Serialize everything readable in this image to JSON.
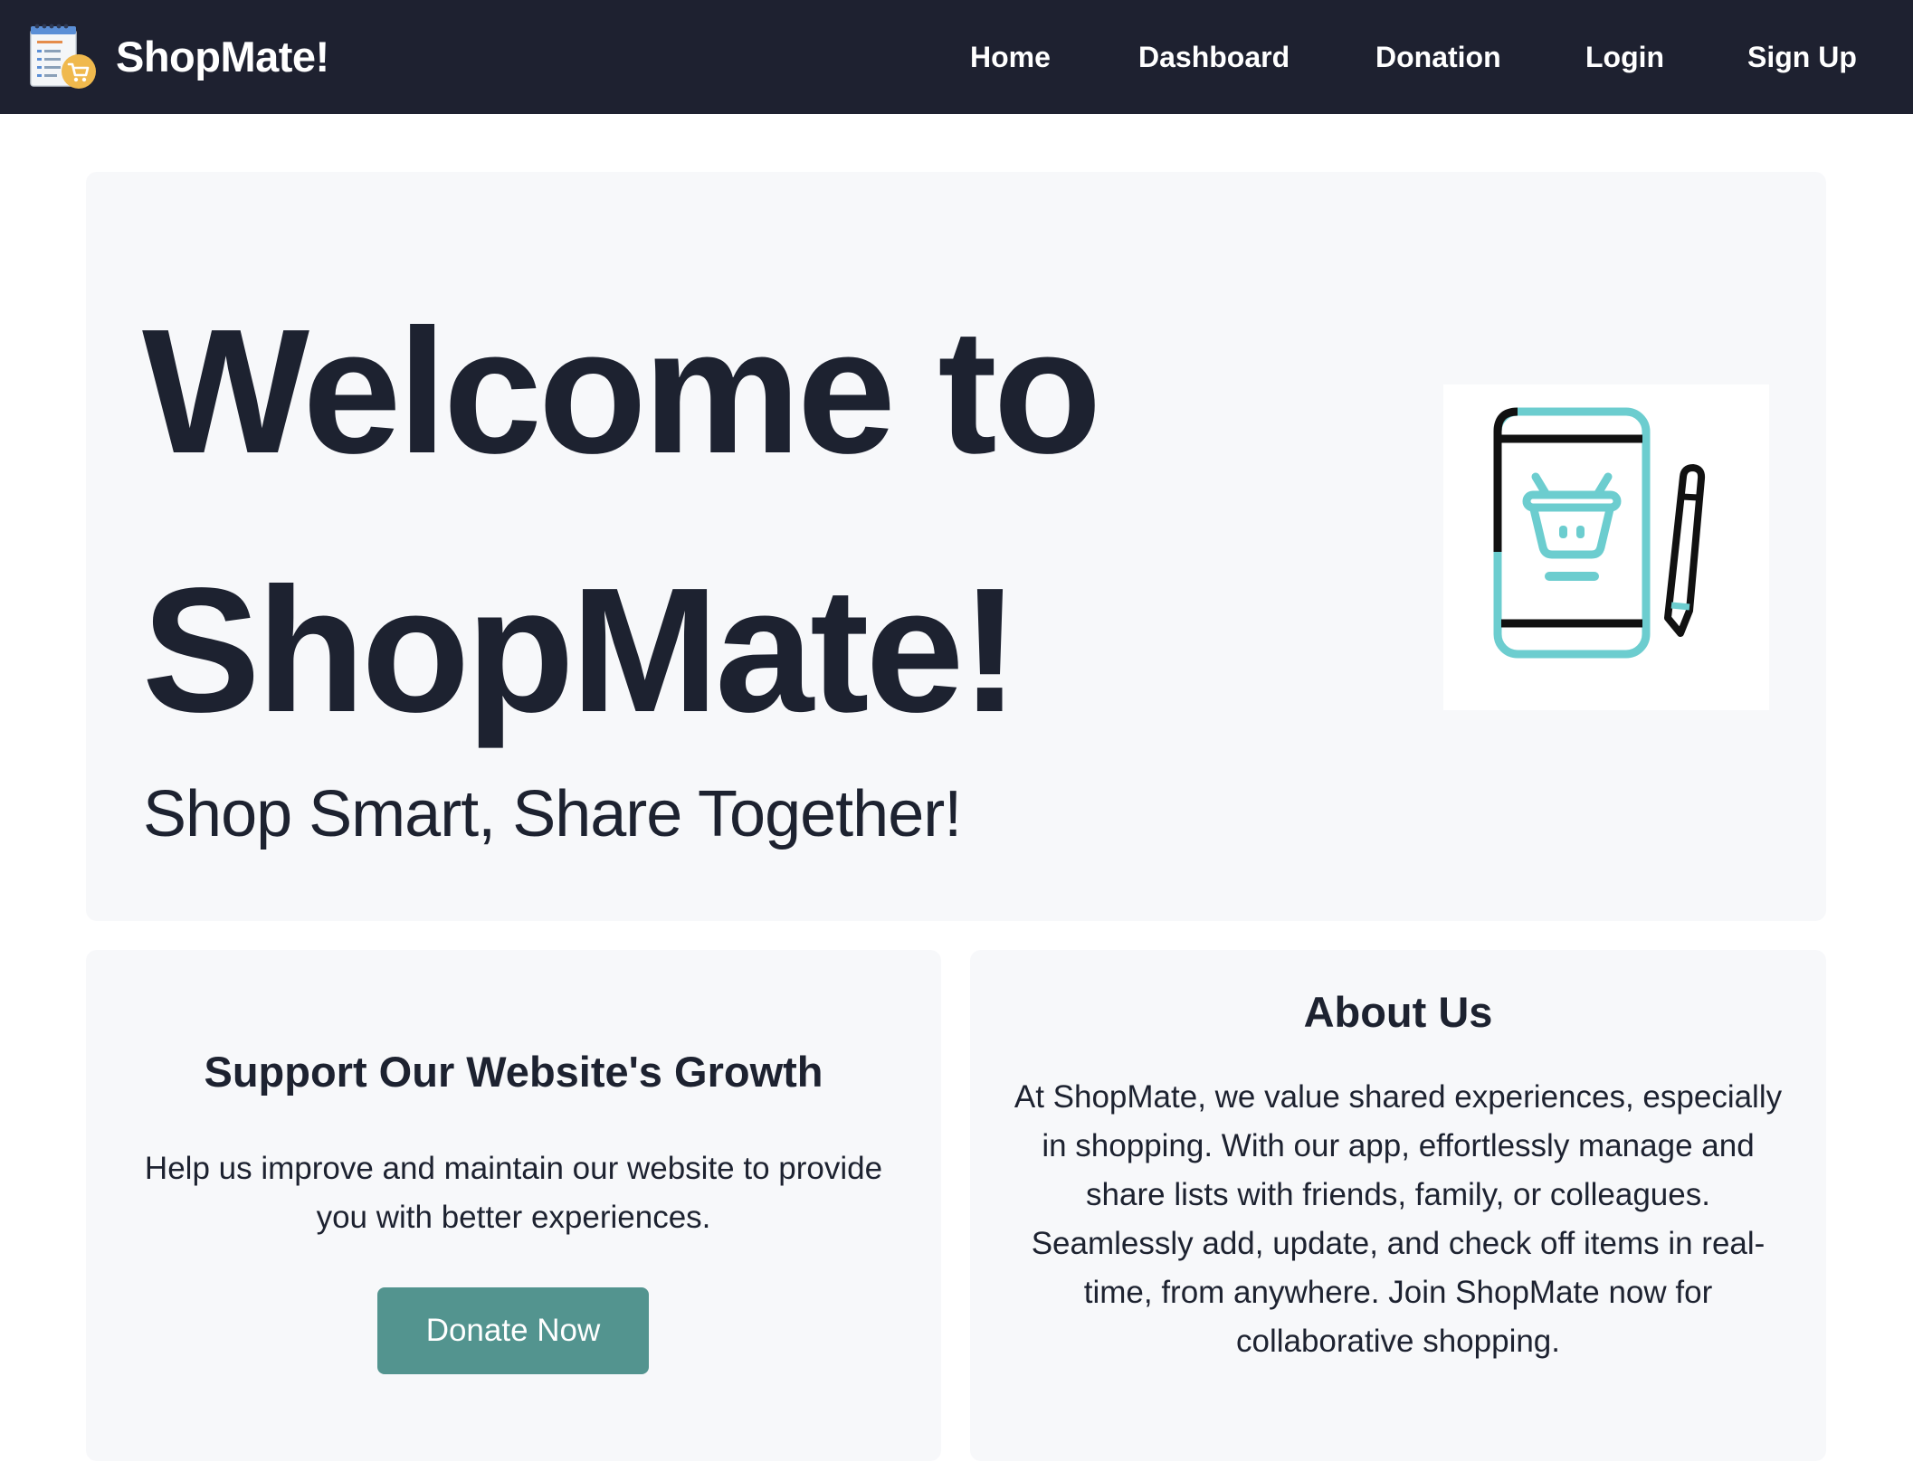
{
  "navbar": {
    "brand_name": "ShopMate!",
    "logo_icon": "shopping-list-cart-icon",
    "links": {
      "home": "Home",
      "dashboard": "Dashboard",
      "donation": "Donation",
      "login": "Login",
      "signup": "Sign Up"
    }
  },
  "hero": {
    "title": "Welcome to ShopMate!",
    "subtitle": "Shop Smart, Share Together!",
    "illustration_icon": "phone-shopping-basket-pen-icon"
  },
  "support": {
    "heading": "Support Our Website's Growth",
    "text": "Help us improve and maintain our website to provide you with better experiences.",
    "button_label": "Donate Now"
  },
  "about": {
    "heading": "About Us",
    "text": "At ShopMate, we value shared experiences, especially in shopping. With our app, effortlessly manage and share lists with friends, family, or colleagues. Seamlessly add, update, and check off items in real-time, from anywhere. Join ShopMate now for collaborative shopping."
  },
  "colors": {
    "navbar_bg": "#1e2130",
    "panel_bg": "#f7f8fa",
    "text": "#1d2230",
    "button_bg": "#53948f",
    "illustration_teal": "#6ccdcf",
    "logo_accent": "#f0b94d"
  }
}
